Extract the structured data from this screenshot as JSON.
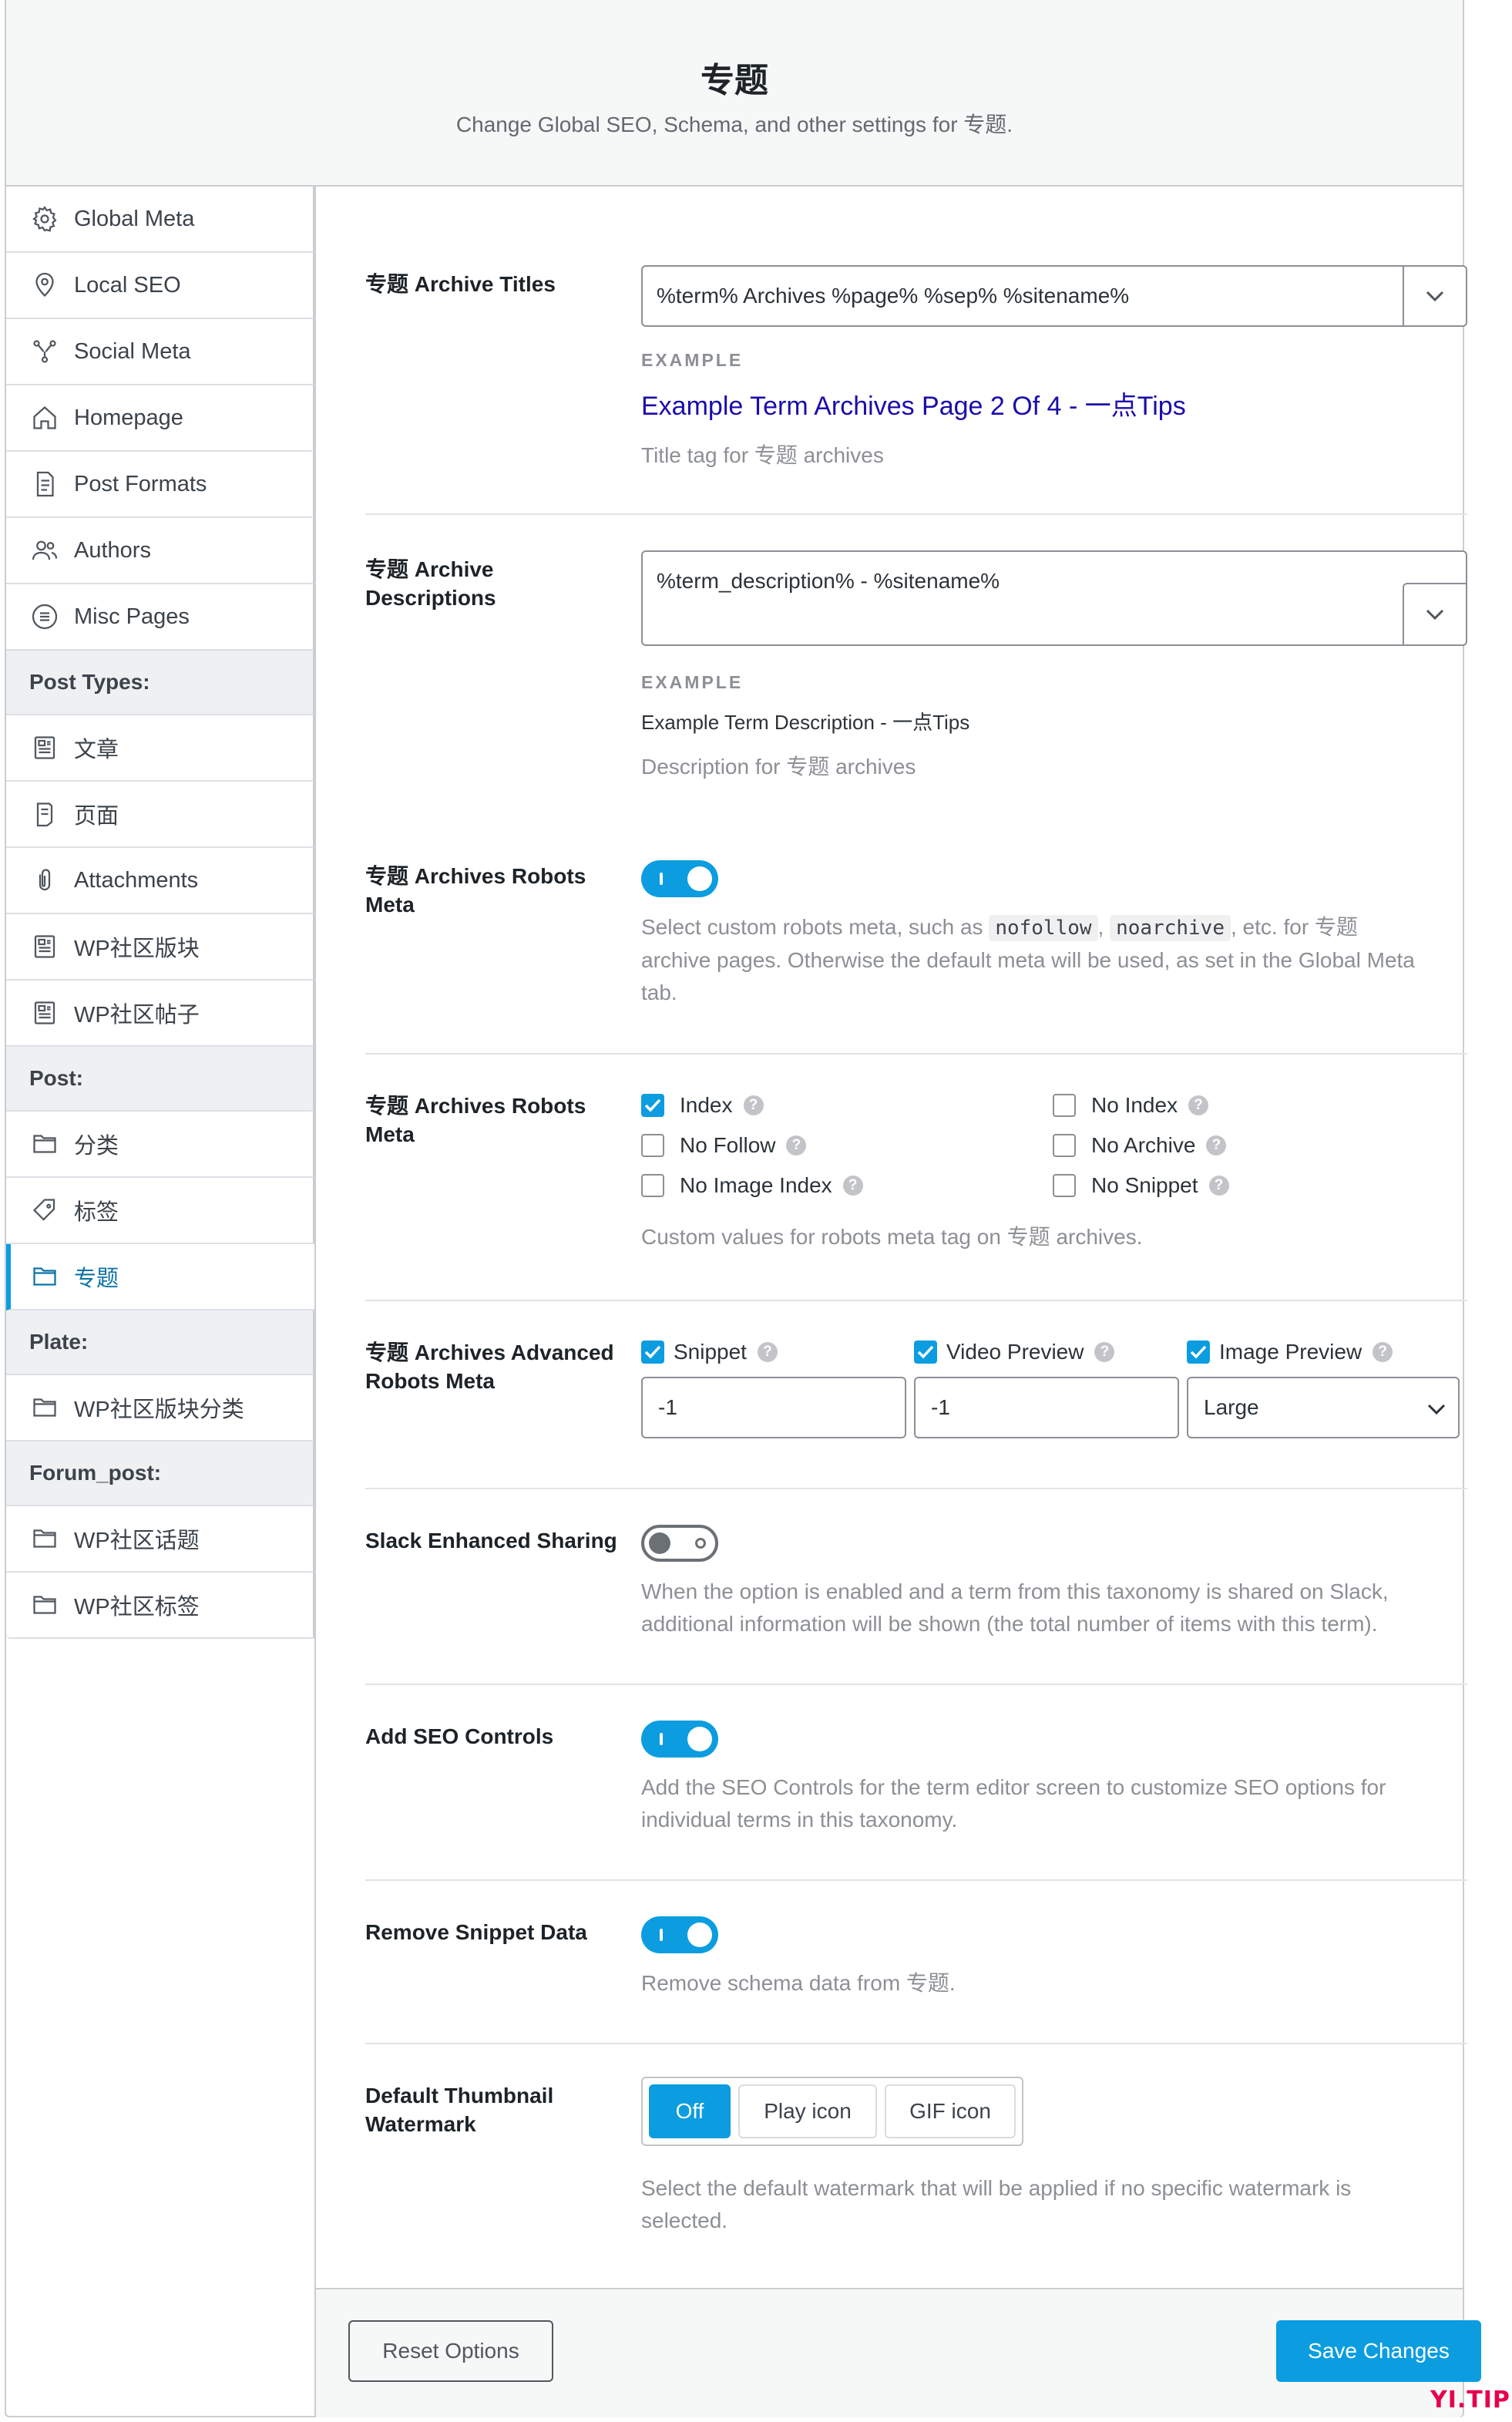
{
  "header": {
    "title": "专题",
    "subtitle": "Change Global SEO, Schema, and other settings for 专题."
  },
  "sidebar": {
    "items": [
      {
        "label": "Global Meta",
        "icon": "gear-icon"
      },
      {
        "label": "Local SEO",
        "icon": "location-pin-icon"
      },
      {
        "label": "Social Meta",
        "icon": "share-icon"
      },
      {
        "label": "Homepage",
        "icon": "home-icon"
      },
      {
        "label": "Post Formats",
        "icon": "document-icon"
      },
      {
        "label": "Authors",
        "icon": "users-icon"
      },
      {
        "label": "Misc Pages",
        "icon": "list-circle-icon"
      }
    ],
    "post_types_heading": "Post Types:",
    "post_types": [
      {
        "label": "文章",
        "icon": "post-icon"
      },
      {
        "label": "页面",
        "icon": "page-icon"
      },
      {
        "label": "Attachments",
        "icon": "paperclip-icon"
      },
      {
        "label": "WP社区版块",
        "icon": "post-icon"
      },
      {
        "label": "WP社区帖子",
        "icon": "post-icon"
      }
    ],
    "post_heading": "Post:",
    "post": [
      {
        "label": "分类",
        "icon": "folder-icon"
      },
      {
        "label": "标签",
        "icon": "tag-icon"
      },
      {
        "label": "专题",
        "icon": "folder-icon",
        "active": true
      }
    ],
    "plate_heading": "Plate:",
    "plate": [
      {
        "label": "WP社区版块分类",
        "icon": "folder-icon"
      }
    ],
    "forum_heading": "Forum_post:",
    "forum": [
      {
        "label": "WP社区话题",
        "icon": "folder-icon"
      },
      {
        "label": "WP社区标签",
        "icon": "folder-icon"
      }
    ]
  },
  "archive_titles": {
    "label": "专题 Archive Titles",
    "value": "%term% Archives %page% %sep% %sitename%",
    "example_label": "EXAMPLE",
    "example_value": "Example Term Archives Page 2 Of 4 - 一点Tips",
    "description": "Title tag for 专题 archives"
  },
  "archive_descriptions": {
    "label": "专题 Archive Descriptions",
    "value": "%term_description% - %sitename%",
    "example_label": "EXAMPLE",
    "example_value": "Example Term Description - 一点Tips",
    "description": "Description for 专题 archives"
  },
  "robots_meta_toggle": {
    "label": "专题 Archives Robots Meta",
    "enabled": true,
    "desc_before": "Select custom robots meta, such as",
    "code1": "nofollow",
    "sep": ",",
    "code2": "noarchive",
    "desc_after": ", etc. for 专题",
    "desc_line2": "archive pages. Otherwise the default meta will be used, as set in the Global Meta",
    "desc_line3": "tab."
  },
  "robots_meta_values": {
    "label": "专题 Archives Robots Meta",
    "options": [
      {
        "label": "Index",
        "checked": true
      },
      {
        "label": "No Index",
        "checked": false
      },
      {
        "label": "No Follow",
        "checked": false
      },
      {
        "label": "No Archive",
        "checked": false
      },
      {
        "label": "No Image Index",
        "checked": false
      },
      {
        "label": "No Snippet",
        "checked": false
      }
    ],
    "description": "Custom values for robots meta tag on 专题 archives."
  },
  "advanced_robots": {
    "label": "专题 Archives Advanced Robots Meta",
    "snippet_label": "Snippet",
    "snippet_value": "-1",
    "video_label": "Video Preview",
    "video_value": "-1",
    "image_label": "Image Preview",
    "image_value": "Large"
  },
  "slack": {
    "label": "Slack Enhanced Sharing",
    "enabled": false,
    "desc_line1": "When the option is enabled and a term from this taxonomy is shared on Slack,",
    "desc_line2": "additional information will be shown (the total number of items with this term)."
  },
  "seo_controls": {
    "label": "Add SEO Controls",
    "enabled": true,
    "desc_line1": "Add the SEO Controls for the term editor screen to customize SEO options for",
    "desc_line2": "individual terms in this taxonomy."
  },
  "remove_snippet": {
    "label": "Remove Snippet Data",
    "enabled": true,
    "description": "Remove schema data from 专题."
  },
  "thumbnail_watermark": {
    "label": "Default Thumbnail Watermark",
    "options": [
      "Off",
      "Play icon",
      "GIF icon"
    ],
    "selected": "Off",
    "desc_line1": "Select the default watermark that will be applied if no specific watermark is",
    "desc_line2": "selected."
  },
  "footer": {
    "reset_label": "Reset Options",
    "save_label": "Save Changes"
  },
  "watermark_text": "YI.TIPS",
  "colors": {
    "accent": "#0b9de0",
    "example_link": "#1a0dab",
    "muted_text": "#8c8f94"
  }
}
